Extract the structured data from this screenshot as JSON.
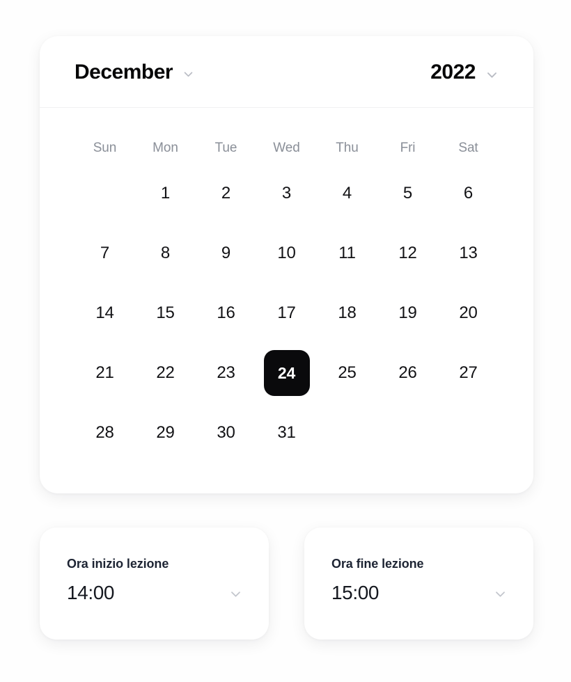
{
  "calendar": {
    "month": {
      "label": "December",
      "chevron_icon": "chevron-down-icon"
    },
    "year": {
      "label": "2022",
      "chevron_icon": "chevron-down-icon"
    },
    "weekdays": [
      "Sun",
      "Mon",
      "Tue",
      "Wed",
      "Thu",
      "Fri",
      "Sat"
    ],
    "weeks": [
      [
        "",
        "1",
        "2",
        "3",
        "4",
        "5",
        "6"
      ],
      [
        "7",
        "8",
        "9",
        "10",
        "11",
        "12",
        "13"
      ],
      [
        "14",
        "15",
        "16",
        "17",
        "18",
        "19",
        "20"
      ],
      [
        "21",
        "22",
        "23",
        "24",
        "25",
        "26",
        "27"
      ],
      [
        "28",
        "29",
        "30",
        "31",
        "",
        "",
        ""
      ]
    ],
    "selected_day": "24",
    "colors": {
      "selected_background": "#0a0a0c",
      "selected_text": "#ffffff",
      "day_text": "#121215",
      "weekday_text": "#8a8f98",
      "card_background": "#ffffff",
      "divider": "#f0f0f2"
    }
  },
  "time_fields": [
    {
      "label": "Ora inizio lezione",
      "value": "14:00",
      "chevron_icon": "chevron-down-icon"
    },
    {
      "label": "Ora fine lezione",
      "value": "15:00",
      "chevron_icon": "chevron-down-icon"
    }
  ]
}
